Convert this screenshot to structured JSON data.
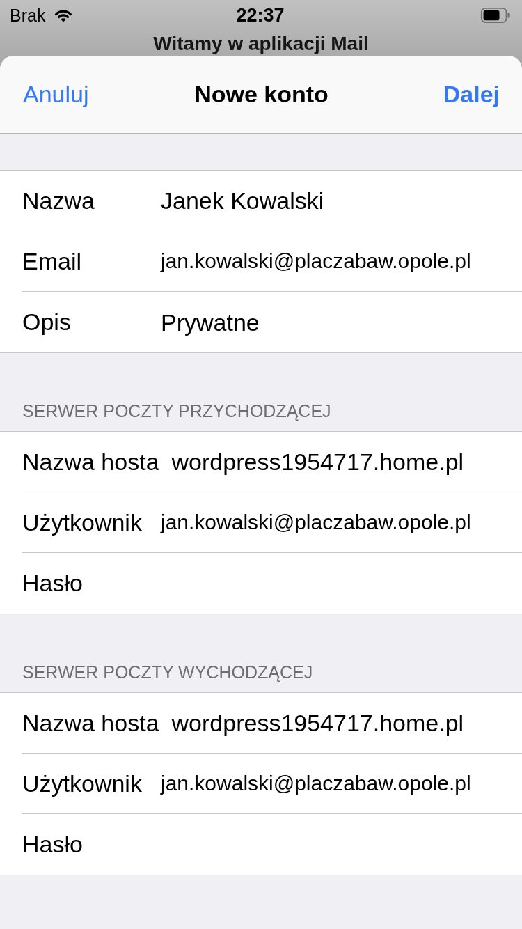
{
  "status_bar": {
    "carrier": "Brak",
    "time": "22:37"
  },
  "background": {
    "title": "Witamy w aplikacji Mail"
  },
  "nav": {
    "cancel": "Anuluj",
    "title": "Nowe konto",
    "next": "Dalej"
  },
  "sections": [
    {
      "rows": [
        {
          "label": "Nazwa",
          "value": "Janek Kowalski"
        },
        {
          "label": "Email",
          "value": "jan.kowalski@placzabaw.opole.pl"
        },
        {
          "label": "Opis",
          "value": "Prywatne"
        }
      ]
    },
    {
      "header": "SERWER POCZTY PRZYCHODZĄCEJ",
      "rows": [
        {
          "label": "Nazwa hosta",
          "value": "wordpress1954717.home.pl"
        },
        {
          "label": "Użytkownik",
          "value": "jan.kowalski@placzabaw.opole.pl"
        },
        {
          "label": "Hasło"
        }
      ]
    },
    {
      "header": "SERWER POCZTY WYCHODZĄCEJ",
      "rows": [
        {
          "label": "Nazwa hosta",
          "value": "wordpress1954717.home.pl"
        },
        {
          "label": "Użytkownik",
          "value": "jan.kowalski@placzabaw.opole.pl"
        },
        {
          "label": "Hasło"
        }
      ]
    }
  ]
}
